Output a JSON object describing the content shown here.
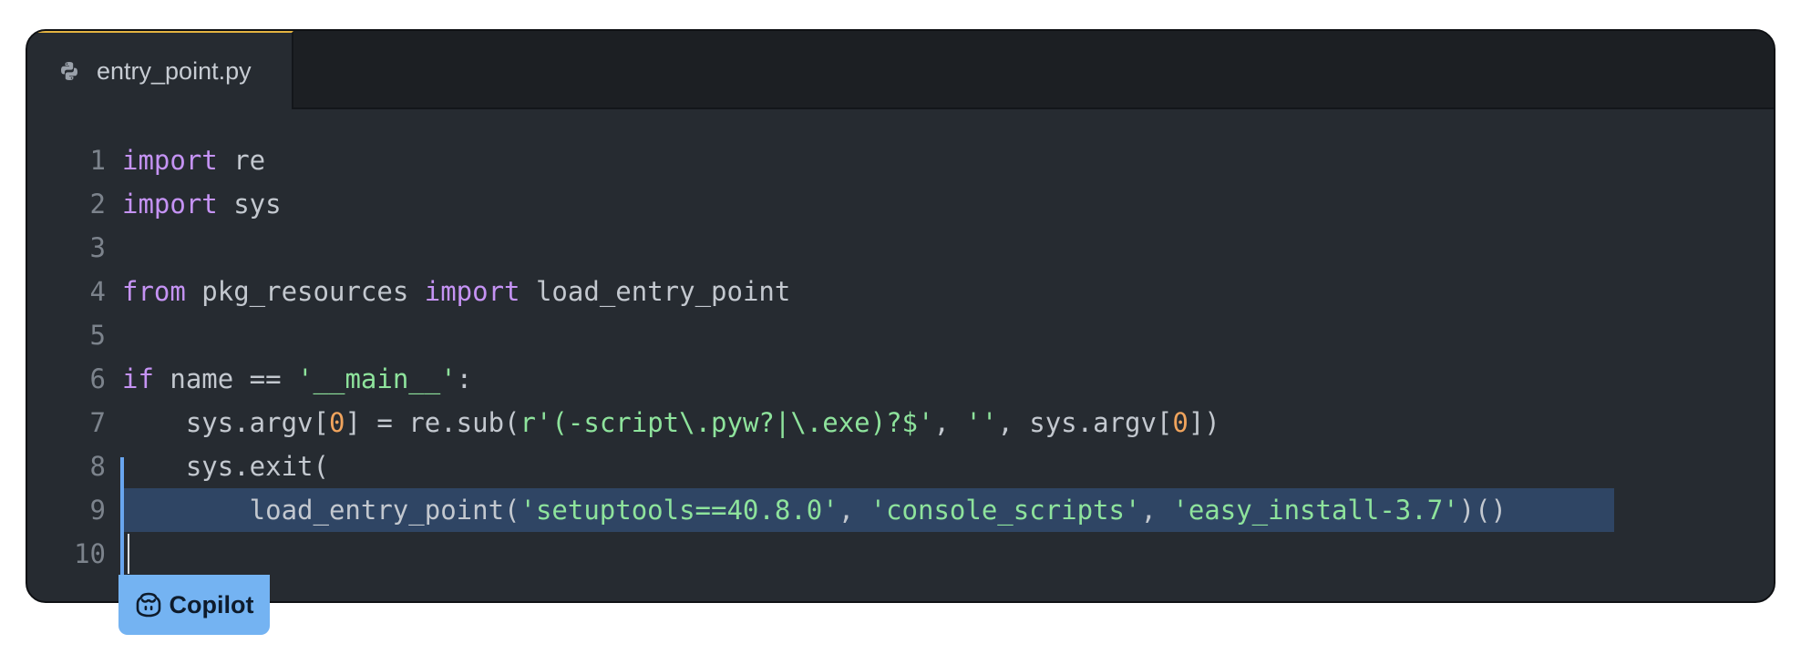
{
  "tab": {
    "filename": "entry_point.py",
    "icon": "python-icon"
  },
  "code": {
    "lines": [
      {
        "number": "1",
        "tokens": [
          [
            "kw",
            "import"
          ],
          [
            "pl",
            " re"
          ]
        ]
      },
      {
        "number": "2",
        "tokens": [
          [
            "kw",
            "import"
          ],
          [
            "pl",
            " sys"
          ]
        ]
      },
      {
        "number": "3",
        "tokens": []
      },
      {
        "number": "4",
        "tokens": [
          [
            "kw",
            "from"
          ],
          [
            "pl",
            " pkg_resources "
          ],
          [
            "kw",
            "import"
          ],
          [
            "pl",
            " load_entry_point"
          ]
        ]
      },
      {
        "number": "5",
        "tokens": []
      },
      {
        "number": "6",
        "tokens": [
          [
            "kw",
            "if"
          ],
          [
            "pl",
            " name == "
          ],
          [
            "st",
            "'__main__'"
          ],
          [
            "pl",
            ":"
          ]
        ]
      },
      {
        "number": "7",
        "tokens": [
          [
            "pl",
            "    sys.argv["
          ],
          [
            "nm",
            "0"
          ],
          [
            "pl",
            "] = re.sub("
          ],
          [
            "st",
            "r'(-script\\.pyw?|\\.exe)?$'"
          ],
          [
            "pl",
            ", "
          ],
          [
            "st",
            "''"
          ],
          [
            "pl",
            ", sys.argv["
          ],
          [
            "nm",
            "0"
          ],
          [
            "pl",
            "])"
          ]
        ]
      },
      {
        "number": "8",
        "tokens": [
          [
            "pl",
            "    sys.exit("
          ]
        ]
      },
      {
        "number": "9",
        "tokens": [
          [
            "pl",
            "        load_entry_point("
          ],
          [
            "st",
            "'setuptools==40.8.0'"
          ],
          [
            "pl",
            ", "
          ],
          [
            "st",
            "'console_scripts'"
          ],
          [
            "pl",
            ", "
          ],
          [
            "st",
            "'easy_install-3.7'"
          ],
          [
            "pl",
            ")()"
          ]
        ],
        "highlighted": true
      },
      {
        "number": "10",
        "tokens": [],
        "cursor": true
      }
    ]
  },
  "copilot": {
    "label": "Copilot",
    "icon": "copilot-icon"
  },
  "colors": {
    "keyword": "#c593f4",
    "string": "#8ee39c",
    "number": "#f0a45d",
    "plain": "#c3c8cf",
    "selection": "#2f4564",
    "accent": "#74b3f2"
  }
}
